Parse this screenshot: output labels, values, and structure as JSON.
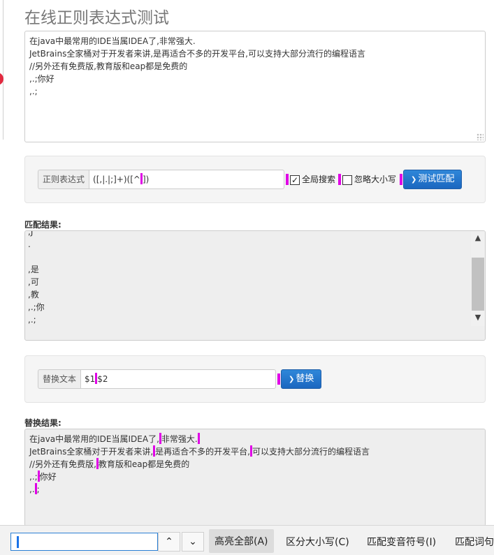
{
  "page": {
    "title": "在线正则表达式测试"
  },
  "source_text": {
    "lines": [
      "在java中最常用的IDE当属IDEA了,非常强大.",
      "JetBrains全家桶对于开发者来讲,是再适合不多的开发平台,可以支持大部分流行的编程语言",
      "//另外还有免费版,教育版和eap都是免费的",
      ",.;你好",
      ",.;"
    ]
  },
  "regex": {
    "label": "正则表达式",
    "value_before": "([,|.|;]+)([^",
    "value_after": "])",
    "global_label": "全局搜索",
    "global_checked": "✓",
    "ignore_case_label": "忽略大小写",
    "test_button": "测试匹配"
  },
  "match_result": {
    "label": "匹配结果:",
    "lines": [
      ",J",
      ".",
      "",
      ",是",
      ",可",
      ",教",
      ",.;你",
      ",.;"
    ]
  },
  "replace": {
    "label": "替换文本",
    "value_a": "$1",
    "value_b": "$2",
    "button": "替换"
  },
  "replace_result": {
    "label": "替换结果:",
    "rows": [
      {
        "a": "在java中最常用的IDE当属IDEA了,",
        "b": "非常强大.",
        "c": ""
      },
      {
        "a": "JetBrains全家桶对于开发者来讲,",
        "b": "是再适合不多的开发平台,",
        "c": "可以支持大部分流行的编程语言"
      },
      {
        "a": "//另外还有免费版,",
        "b": "教育版和eap都是免费的",
        "c": ""
      },
      {
        "a": ",.;",
        "b": "你好",
        "c": ""
      },
      {
        "a": ",.",
        "b": ";",
        "c": ""
      }
    ]
  },
  "findbar": {
    "highlight_all": "高亮全部(A)",
    "match_case": "区分大小写(C)",
    "match_diacritics": "匹配变音符号(I)",
    "whole_words": "匹配词句"
  },
  "colors": {
    "highlight": "#e000e6",
    "button": "#1b67c0"
  }
}
